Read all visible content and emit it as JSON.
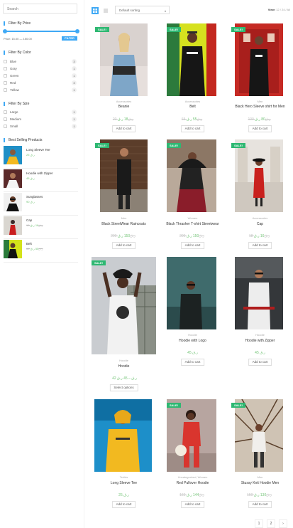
{
  "search": {
    "placeholder": "Search"
  },
  "price_filter": {
    "title": "Filter By Price",
    "range_label": "Price: 15.00 — 150.00",
    "button": "FILTER"
  },
  "color_filter": {
    "title": "Filter By Color",
    "items": [
      {
        "label": "Blue",
        "count": "3"
      },
      {
        "label": "Gray",
        "count": "1"
      },
      {
        "label": "Green",
        "count": "1"
      },
      {
        "label": "Red",
        "count": "3"
      },
      {
        "label": "Yellow",
        "count": "1"
      }
    ]
  },
  "size_filter": {
    "title": "Filter By Size",
    "items": [
      {
        "label": "Large",
        "count": "1"
      },
      {
        "label": "Medium",
        "count": "1"
      },
      {
        "label": "Small",
        "count": "1"
      }
    ]
  },
  "best_selling": {
    "title": "Best Selling Products",
    "items": [
      {
        "name": "Long Sleeve Tee",
        "price": "25 ر.ق",
        "old": ""
      },
      {
        "name": "Hoodie with Zipper",
        "price": "45 ر.ق",
        "old": ""
      },
      {
        "name": "Sunglasses",
        "price": "90 ر.ق",
        "old": ""
      },
      {
        "name": "Cap",
        "price": "16 ر.ق",
        "old": "18 ر.ق"
      },
      {
        "name": "Belt",
        "price": "55 ر.ق",
        "old": "65 ر.ق"
      }
    ]
  },
  "toolbar": {
    "sort_value": "Default sorting",
    "view_label": "View:",
    "view_options": "12 / 24 / All"
  },
  "products": [
    {
      "sale": "SALE!",
      "cat": "Accessories",
      "name": "Beanie",
      "old": "20 ر.ق",
      "price": "18 ر.ق",
      "button": "Add to cart"
    },
    {
      "sale": "SALE!",
      "cat": "Accessories",
      "name": "Belt",
      "old": "65 ر.ق",
      "price": "55 ر.ق",
      "button": "Add to cart"
    },
    {
      "sale": "SALE!",
      "cat": "Men",
      "name": "Black Hero Sleeve shirt for Men",
      "old": "100 ر.ق",
      "price": "80 ر.ق",
      "button": "Add to cart"
    },
    {
      "sale": "SALE!",
      "cat": "Men",
      "name": "Black StreetWear Raincoats",
      "old": "200 ر.ق",
      "price": "150 ر.ق",
      "button": "Add to cart"
    },
    {
      "sale": "SALE!",
      "cat": "Women",
      "name": "Black Thrasher T-shirt Streetwear",
      "old": "200 ر.ق",
      "price": "150 ر.ق",
      "button": "Add to cart"
    },
    {
      "sale": "SALE!",
      "cat": "Accessories",
      "name": "Cap",
      "old": "18 ر.ق",
      "price": "16 ر.ق",
      "button": "Add to cart"
    },
    {
      "sale": "SALE!",
      "cat": "Hoodie",
      "name": "Hoodie",
      "old": "",
      "price": "42 ر.ق – 45 ر.ق",
      "button": "Select options"
    },
    {
      "sale": "",
      "cat": "Hoodie",
      "name": "Hoodie with Logo",
      "old": "",
      "price": "45 ر.ق",
      "button": "Add to cart"
    },
    {
      "sale": "",
      "cat": "Hoodie",
      "name": "Hoodie with Zipper",
      "old": "",
      "price": "45 ر.ق",
      "button": "Add to cart"
    },
    {
      "sale": "",
      "cat": "Tshirts",
      "name": "Long Sleeve Tee",
      "old": "",
      "price": "25 ر.ق",
      "button": "Add to cart"
    },
    {
      "sale": "SALE!",
      "cat": "Uncategorized, Women",
      "name": "Red Pullover Hoodie",
      "old": "160 ر.ق",
      "price": "144 ر.ق",
      "button": "Add to cart"
    },
    {
      "sale": "SALE!",
      "cat": "Men",
      "name": "Stussy Knit Hoodie Men",
      "old": "150 ر.ق",
      "price": "130 ر.ق",
      "button": "Add to cart"
    }
  ],
  "pagination": {
    "pages": [
      "1",
      "2"
    ],
    "next": "›"
  },
  "colors": {
    "accent": "#3fa9f5",
    "sale": "#2eb872",
    "price": "#74c478"
  }
}
